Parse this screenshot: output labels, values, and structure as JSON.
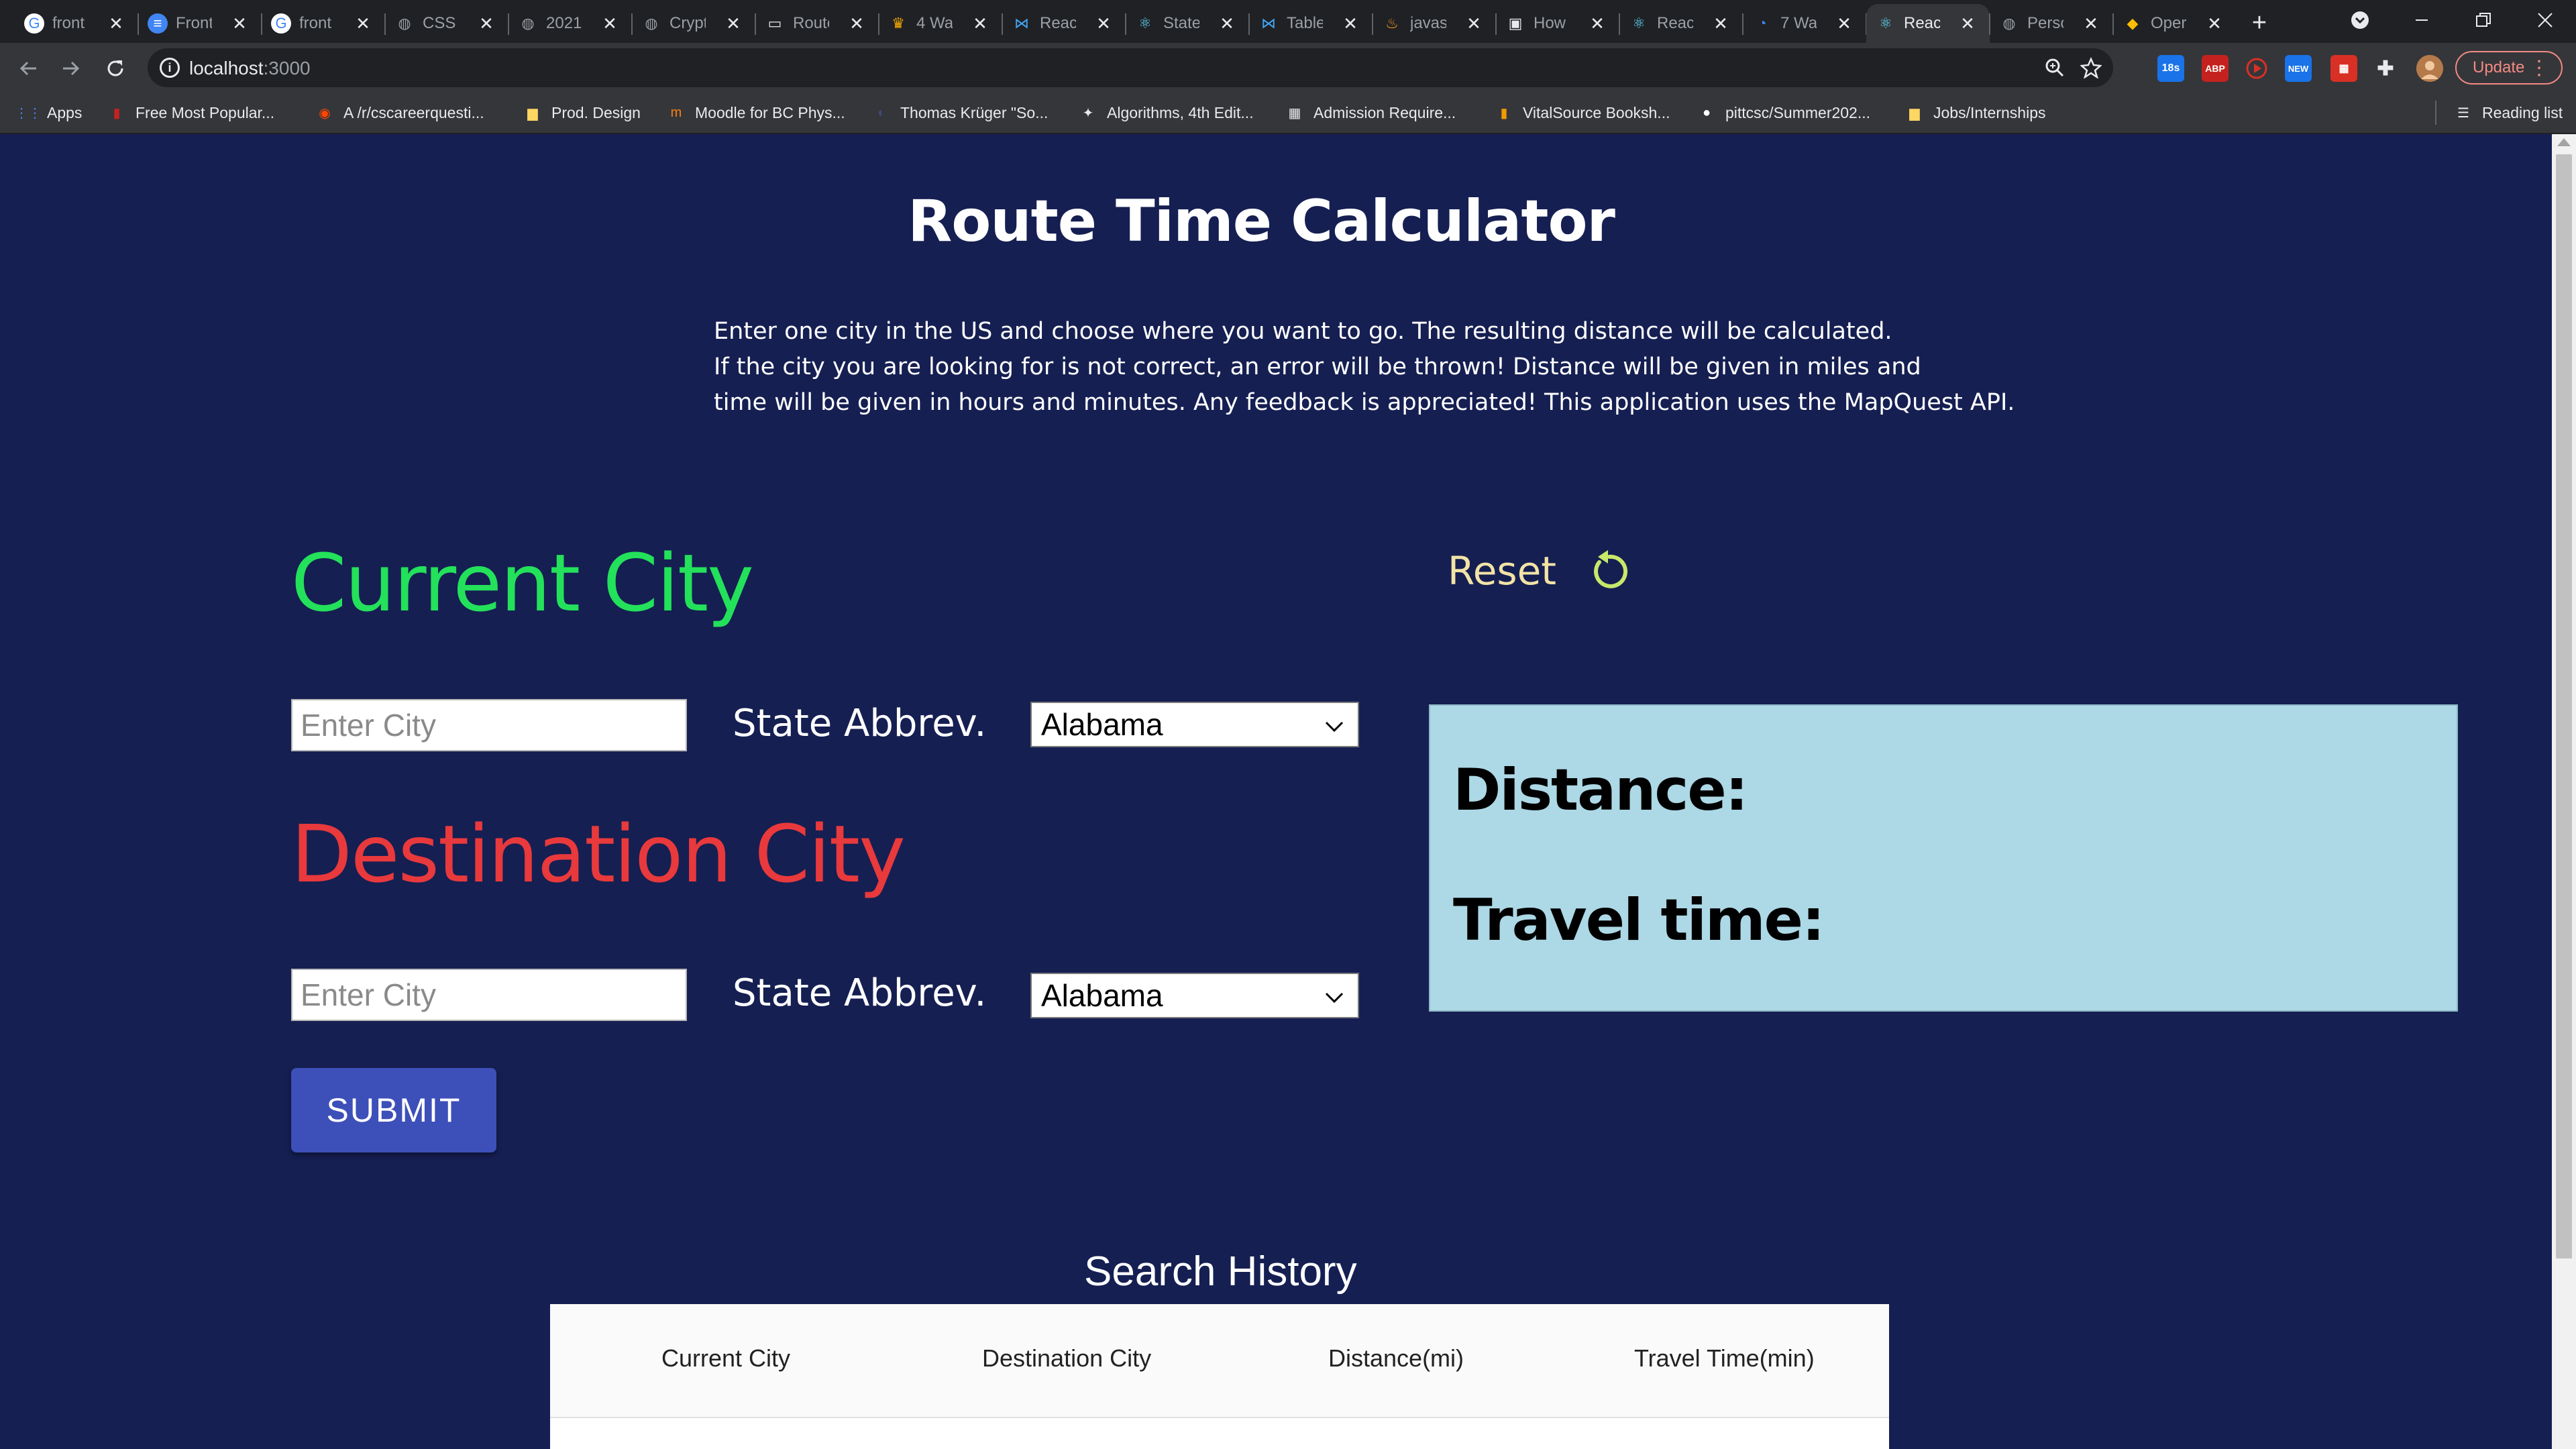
{
  "browser": {
    "tabs": [
      {
        "title": "front",
        "icon": "google-g-icon"
      },
      {
        "title": "Front",
        "icon": "google-docs-icon"
      },
      {
        "title": "front",
        "icon": "google-g-icon"
      },
      {
        "title": "CSS S",
        "icon": "globe-icon"
      },
      {
        "title": "2021",
        "icon": "globe-icon"
      },
      {
        "title": "Crypt",
        "icon": "globe-icon"
      },
      {
        "title": "Route",
        "icon": "codesandbox-icon"
      },
      {
        "title": "4 Wa",
        "icon": "medal-icon"
      },
      {
        "title": "React",
        "icon": "mui-icon"
      },
      {
        "title": "State",
        "icon": "react-icon"
      },
      {
        "title": "Table",
        "icon": "mui-icon"
      },
      {
        "title": "javas",
        "icon": "java-icon"
      },
      {
        "title": "How",
        "icon": "terminal-icon"
      },
      {
        "title": "React",
        "icon": "react-icon"
      },
      {
        "title": "7 Wa",
        "icon": "loader-icon"
      },
      {
        "title": "React",
        "icon": "react-icon"
      },
      {
        "title": "Perso",
        "icon": "globe-icon"
      },
      {
        "title": "Oper",
        "icon": "colorful-icon"
      }
    ],
    "active_tab_index": 15,
    "url": "localhost",
    "url_port": ":3000",
    "update_label": "Update",
    "bookmarks": [
      {
        "label": "Apps",
        "icon": "apps-grid-icon",
        "color": "#4285f4"
      },
      {
        "label": "Free Most Popular...",
        "icon": "bookmark-red-icon",
        "color": "#c5221f"
      },
      {
        "label": "A /r/cscareerquesti...",
        "icon": "reddit-icon",
        "color": "#ff4500"
      },
      {
        "label": "Prod. Design",
        "icon": "folder-icon",
        "color": "#fdd663"
      },
      {
        "label": "Moodle for BC Phys...",
        "icon": "moodle-icon",
        "color": "#f98012"
      },
      {
        "label": "Thomas Krüger \"So...",
        "icon": "profile-icon",
        "color": "#3c4a7a"
      },
      {
        "label": "Algorithms, 4th Edit...",
        "icon": "algorithm-icon",
        "color": "#e8eaed"
      },
      {
        "label": "Admission Require...",
        "icon": "hcde-icon",
        "color": "#e8eaed"
      },
      {
        "label": "VitalSource Booksh...",
        "icon": "book-icon",
        "color": "#f29900"
      },
      {
        "label": "pittcsc/Summer202...",
        "icon": "github-icon",
        "color": "#ffffff"
      },
      {
        "label": "Jobs/Internships",
        "icon": "folder-icon",
        "color": "#fdd663"
      }
    ],
    "reading_list_label": "Reading list"
  },
  "page": {
    "title": "Route Time Calculator",
    "description_lines": [
      "Enter one city in the US and choose where you want to go. The resulting distance will be calculated.",
      "If the city you are looking for is not correct, an error will be thrown! Distance will be given in miles and",
      "time will be given in hours and minutes. Any feedback is appreciated! This application uses the MapQuest API."
    ],
    "current_city": {
      "heading": "Current City",
      "input_placeholder": "Enter City",
      "input_value": "",
      "state_label": "State Abbrev.",
      "state_selected": "Alabama"
    },
    "destination_city": {
      "heading": "Destination City",
      "input_placeholder": "Enter City",
      "input_value": "",
      "state_label": "State Abbrev.",
      "state_selected": "Alabama"
    },
    "submit_label": "SUBMIT",
    "reset_label": "Reset",
    "result": {
      "distance_label": "Distance:",
      "distance_value": "",
      "time_label": "Travel time:",
      "time_value": ""
    },
    "history": {
      "title": "Search History",
      "columns": [
        "Current City",
        "Destination City",
        "Distance(mi)",
        "Travel Time(min)"
      ],
      "rows": []
    }
  },
  "colors": {
    "page_bg": "#151f52",
    "current_heading": "#23e15a",
    "destination_heading": "#e8393c",
    "result_bg": "#add8e6",
    "submit_bg": "#3d4fb8",
    "reset_text": "#f3e3a6"
  }
}
